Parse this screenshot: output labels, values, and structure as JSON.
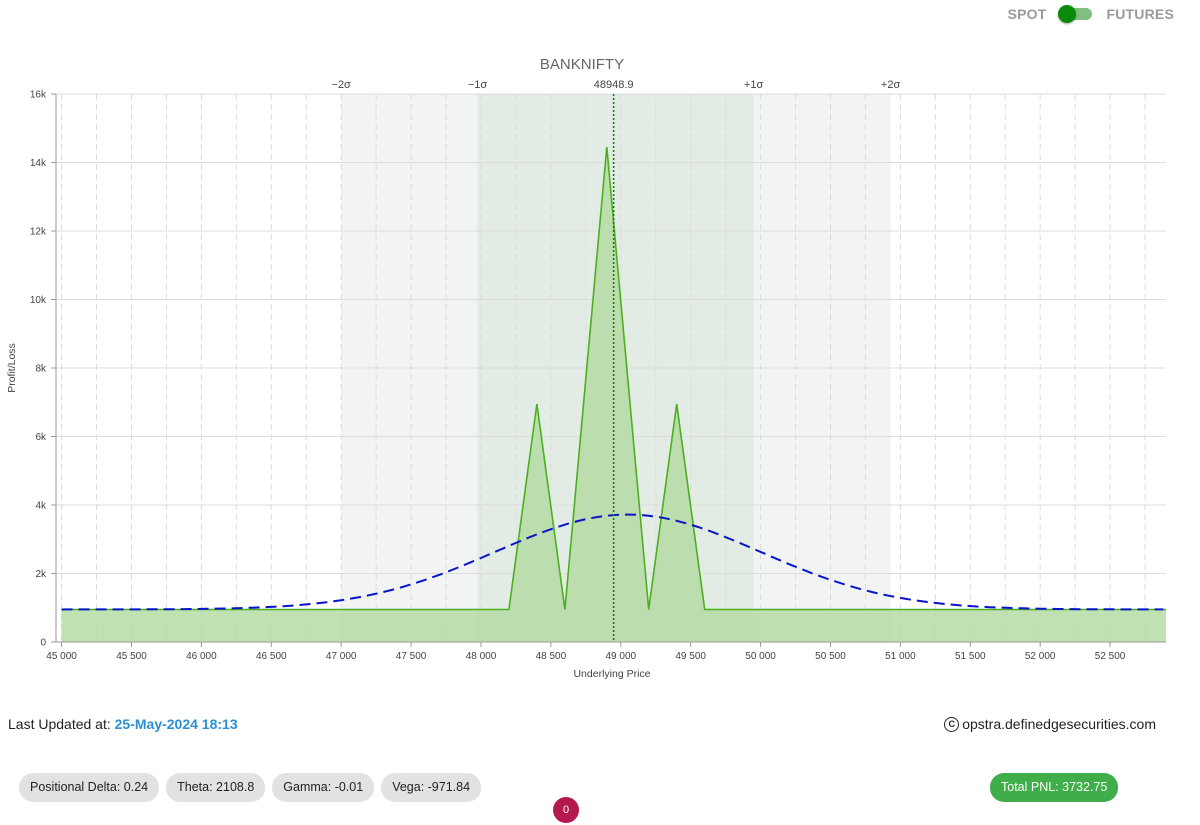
{
  "header": {
    "spot_label": "SPOT",
    "futures_label": "FUTURES"
  },
  "chart_data": {
    "type": "area",
    "title": "BANKNIFTY",
    "xlabel": "Underlying Price",
    "ylabel": "Profit/Loss",
    "xlim": [
      44960,
      52900
    ],
    "ylim": [
      0,
      16000
    ],
    "x_ticks": [
      45000,
      45500,
      46000,
      46500,
      47000,
      47500,
      48000,
      48500,
      49000,
      49500,
      50000,
      50500,
      51000,
      51500,
      52000,
      52500
    ],
    "x_tick_labels": [
      "45 000",
      "45 500",
      "46 000",
      "46 500",
      "47 000",
      "47 500",
      "48 000",
      "48 500",
      "49 000",
      "49 500",
      "50 000",
      "50 500",
      "51 000",
      "51 500",
      "52 000",
      "52 500"
    ],
    "y_ticks": [
      0,
      2000,
      4000,
      6000,
      8000,
      10000,
      12000,
      14000,
      16000
    ],
    "y_tick_labels": [
      "0",
      "2k",
      "4k",
      "6k",
      "8k",
      "10k",
      "12k",
      "14k",
      "16k"
    ],
    "grid": true,
    "current_price": {
      "value": 48948.9,
      "label": "48948.9"
    },
    "sigma_bands": [
      {
        "label": "−2σ",
        "value": 47000
      },
      {
        "label": "−1σ",
        "value": 47975
      },
      {
        "label": "+1σ",
        "value": 49950
      },
      {
        "label": "+2σ",
        "value": 50930
      }
    ],
    "series": [
      {
        "type": "area",
        "color": "#4caf1f",
        "fill": "#b5dca4",
        "x": [
          45000,
          48200,
          48400,
          48600,
          48900,
          49200,
          49400,
          49600,
          52900
        ],
        "y": [
          950,
          950,
          6950,
          950,
          14450,
          950,
          6950,
          950,
          950
        ]
      },
      {
        "type": "dashed-line",
        "color": "#0a14c8",
        "mean": 49050,
        "sd": 950,
        "baseline": 950,
        "peak": 3720,
        "x_range": [
          45000,
          52900
        ]
      }
    ]
  },
  "footer": {
    "updated_label": "Last Updated at:",
    "updated_value": "25-May-2024 18:13",
    "copyright_text": "opstra.definedgesecurities.com"
  },
  "stats": [
    {
      "label": "Positional Delta: 0.24"
    },
    {
      "label": "Theta: 2108.8"
    },
    {
      "label": "Gamma: -0.01"
    },
    {
      "label": "Vega: -971.84"
    }
  ],
  "total_pnl": "Total PNL: 3732.75",
  "badge_count": "0",
  "colors": {
    "accent_green": "#3fae49",
    "toggle_green": "#0a8a0a",
    "date_blue": "#2a8fd6",
    "badge": "#b5184f"
  }
}
